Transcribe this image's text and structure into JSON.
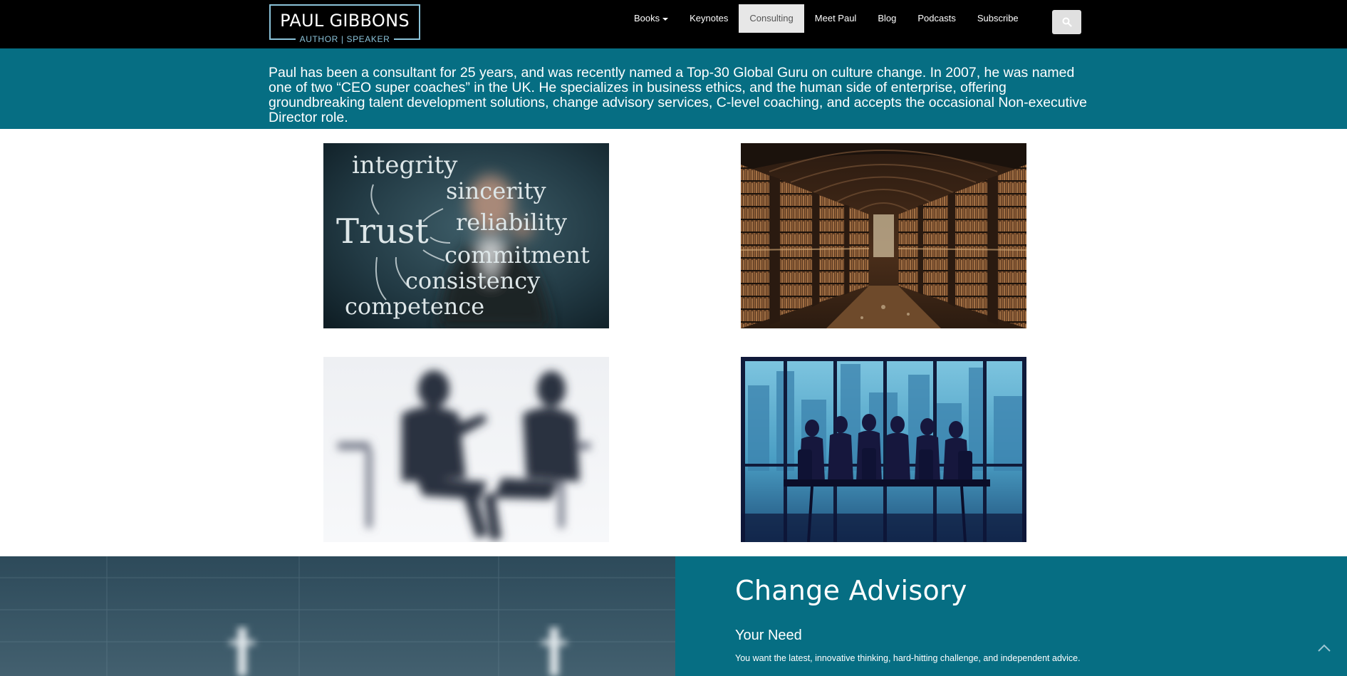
{
  "header": {
    "logo_name": "PAUL GIBBONS",
    "logo_tagline": "AUTHOR  |  SPEAKER",
    "nav": [
      {
        "label": "Books",
        "has_dropdown": true
      },
      {
        "label": "Keynotes"
      },
      {
        "label": "Consulting",
        "active": true
      },
      {
        "label": "Meet Paul"
      },
      {
        "label": "Blog"
      },
      {
        "label": "Podcasts"
      },
      {
        "label": "Subscribe"
      }
    ],
    "search_icon": "search-icon"
  },
  "intro": {
    "text": "Paul has been a consultant for 25 years, and was recently named a Top-30 Global Guru on culture change. In 2007, he was named one of two “CEO super coaches” in the UK. He specializes in business ethics, and the human side of enterprise, offering groundbreaking talent development solutions, change advisory services, C-level coaching, and accepts the occasional Non-executive Director role."
  },
  "gallery": {
    "trust_words": [
      "integrity",
      "sincerity",
      "Trust",
      "reliability",
      "commitment",
      "consistency",
      "competence"
    ]
  },
  "section": {
    "title": "Change Advisory",
    "subtitle": "Your Need",
    "body": "You want the latest, innovative thinking, hard-hitting challenge, and independent advice."
  },
  "icons": {
    "scroll_top": "chevron-up-icon"
  },
  "colors": {
    "teal": "#066e83",
    "header_bg": "#000000",
    "logo_accent": "#8ac2d8"
  }
}
